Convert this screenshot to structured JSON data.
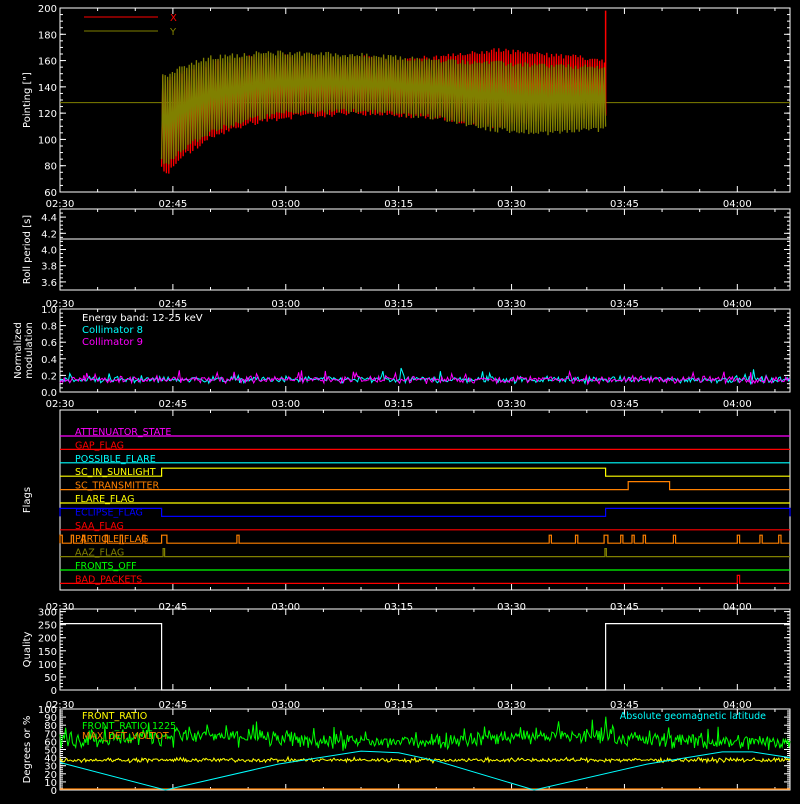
{
  "chart_data": [
    {
      "type": "line",
      "panel": "pointing",
      "ylabel": "Pointing [\"]",
      "ylim": [
        60,
        200
      ],
      "yticks": [
        60,
        80,
        100,
        120,
        140,
        160,
        180,
        200
      ],
      "xlim_minutes": [
        0,
        97
      ],
      "xticks": [
        "02:30",
        "02:45",
        "03:00",
        "03:15",
        "03:30",
        "03:45",
        "04:00"
      ],
      "xticks_minutes": [
        0,
        15,
        30,
        45,
        60,
        75,
        90
      ],
      "legend": [
        {
          "name": "X",
          "color": "#ff0000"
        },
        {
          "name": "Y",
          "color": "#808000"
        }
      ],
      "series": [
        {
          "name": "X",
          "color": "#ff0000",
          "envelope_x": [
            "02:43.5",
            "02:44",
            "02:46",
            "02:50",
            "02:55",
            "03:00",
            "03:10",
            "03:20",
            "03:28",
            "03:35",
            "03:40",
            "03:42.5"
          ],
          "upper": [
            150,
            143,
            150,
            158,
            162,
            163,
            162,
            162,
            168,
            164,
            162,
            160
          ],
          "lower": [
            80,
            72,
            86,
            101,
            112,
            117,
            120,
            117,
            110,
            114,
            117,
            118
          ],
          "end_spike": 198
        },
        {
          "name": "Y",
          "color": "#808000",
          "envelope_x": [
            "02:43.5",
            "02:44",
            "02:46",
            "02:50",
            "02:55",
            "03:00",
            "03:10",
            "03:20",
            "03:28",
            "03:35",
            "03:40",
            "03:42.5"
          ],
          "upper": [
            153,
            148,
            155,
            162,
            165,
            166,
            164,
            160,
            158,
            156,
            155,
            155
          ],
          "lower": [
            86,
            80,
            92,
            106,
            115,
            120,
            122,
            117,
            107,
            105,
            107,
            108
          ],
          "baseline": 128
        }
      ]
    },
    {
      "type": "line",
      "panel": "roll_period",
      "ylabel": "Roll period [s]",
      "ylim": [
        3.5,
        4.5
      ],
      "yticks": [
        3.6,
        3.8,
        4.0,
        4.2,
        4.4
      ],
      "ytick_labels": [
        "3.6",
        "3.8",
        "4.0",
        "4.2",
        "4.4"
      ],
      "xticks": [
        "02:30",
        "02:45",
        "03:00",
        "03:15",
        "03:30",
        "03:45",
        "04:00"
      ],
      "series": [
        {
          "name": "",
          "color": "#ffffff",
          "constant": 4.13
        }
      ]
    },
    {
      "type": "line",
      "panel": "modulation",
      "ylabel": "Normalized modulation",
      "ylabel_lines": [
        "Normalized",
        "modulation"
      ],
      "ylim": [
        0,
        1
      ],
      "yticks": [
        0,
        0.2,
        0.4,
        0.6,
        0.8,
        1.0
      ],
      "ytick_labels": [
        "0.0",
        "0.2",
        "0.4",
        "0.6",
        "0.8",
        "1.0"
      ],
      "xticks": [
        "02:30",
        "02:45",
        "03:00",
        "03:15",
        "03:30",
        "03:45",
        "04:00"
      ],
      "annotation": "Energy band: 12-25 keV",
      "legend": [
        {
          "name": "Collimator 8",
          "color": "#00ffff"
        },
        {
          "name": "Collimator 9",
          "color": "#ff00ff"
        }
      ],
      "series": [
        {
          "name": "Collimator 8",
          "color": "#00ffff",
          "mean": 0.15,
          "noise": 0.04
        },
        {
          "name": "Collimator 9",
          "color": "#ff00ff",
          "mean": 0.15,
          "noise": 0.04
        }
      ]
    },
    {
      "type": "line",
      "panel": "flags",
      "ylabel": "Flags",
      "xticks": [
        "02:30",
        "02:45",
        "03:00",
        "03:15",
        "03:30",
        "03:45",
        "04:00"
      ],
      "flags": [
        {
          "name": "ATTENUATOR_STATE",
          "color": "#ff00ff",
          "on": []
        },
        {
          "name": "GAP_FLAG",
          "color": "#ff0000",
          "on": []
        },
        {
          "name": "POSSIBLE_FLARE",
          "color": "#00ffff",
          "on": []
        },
        {
          "name": "SC_IN_SUNLIGHT",
          "color": "#ffff00",
          "on": [
            [
              "02:43.5",
              "03:42.5"
            ]
          ]
        },
        {
          "name": "SC_TRANSMITTER",
          "color": "#ff8000",
          "on": [
            [
              "03:45.5",
              "03:51"
            ]
          ]
        },
        {
          "name": "FLARE_FLAG",
          "color": "#ffff00",
          "on": []
        },
        {
          "name": "ECLIPSE_FLAG",
          "color": "#0000ff",
          "on": [
            [
              "02:30",
              "02:43.5"
            ],
            [
              "03:42.5",
              "04:07"
            ]
          ]
        },
        {
          "name": "SAA_FLAG",
          "color": "#ff0000",
          "on": []
        },
        {
          "name": "PARTICLE_FLAG",
          "color": "#ff8000",
          "on": [
            [
              "02:30",
              "02:30.3"
            ],
            [
              "02:31.5",
              "02:31.8"
            ],
            [
              "02:33",
              "02:33.3"
            ],
            [
              "02:36",
              "02:36.3"
            ],
            [
              "02:38",
              "02:38.3"
            ],
            [
              "02:41",
              "02:41.3"
            ],
            [
              "02:43.5",
              "02:44.2"
            ],
            [
              "02:53.5",
              "02:53.8"
            ],
            [
              "03:35",
              "03:35.3"
            ],
            [
              "03:38.5",
              "03:38.8"
            ],
            [
              "03:42.3",
              "03:42.8"
            ],
            [
              "03:44.5",
              "03:44.8"
            ],
            [
              "03:46",
              "03:46.3"
            ],
            [
              "03:47.5",
              "03:47.8"
            ],
            [
              "03:51.5",
              "03:51.8"
            ],
            [
              "04:00",
              "04:00.3"
            ],
            [
              "04:03",
              "04:03.3"
            ],
            [
              "04:05.5",
              "04:05.8"
            ]
          ]
        },
        {
          "name": "AAZ_FLAG",
          "color": "#808000",
          "on": [
            [
              "02:43.7",
              "02:43.9"
            ],
            [
              "03:42.4",
              "03:42.6"
            ]
          ]
        },
        {
          "name": "FRONTS_OFF",
          "color": "#00ff00",
          "on": []
        },
        {
          "name": "BAD_PACKETS",
          "color": "#ff0000",
          "on": [
            [
              "04:00",
              "04:00.3"
            ]
          ]
        }
      ]
    },
    {
      "type": "line",
      "panel": "quality",
      "ylabel": "Quality",
      "ylim": [
        0,
        310
      ],
      "yticks": [
        0,
        50,
        100,
        150,
        200,
        250,
        300
      ],
      "xticks": [
        "02:30",
        "02:45",
        "03:00",
        "03:15",
        "03:30",
        "03:45",
        "04:00"
      ],
      "series": [
        {
          "name": "",
          "color": "#ffffff",
          "steps": [
            [
              "02:30",
              254
            ],
            [
              "02:43.5",
              0
            ],
            [
              "03:42.5",
              254
            ],
            [
              "04:07",
              254
            ]
          ]
        }
      ]
    },
    {
      "type": "line",
      "panel": "ratios",
      "ylabel": "Degrees or %",
      "ylim": [
        0,
        100
      ],
      "yticks": [
        0,
        10,
        20,
        30,
        40,
        50,
        60,
        70,
        80,
        90,
        100
      ],
      "xticks": [
        "02:30",
        "02:45",
        "03:00",
        "03:15",
        "03:30",
        "03:45",
        "04:00"
      ],
      "legend": [
        {
          "name": "FRONT_RATIO",
          "color": "#ffff00"
        },
        {
          "name": "FRONT_RATIO_1225",
          "color": "#00ff00"
        },
        {
          "name": "MAX_DET_VOLTOT",
          "color": "#ff8000"
        }
      ],
      "annotation": "Absolute geomagnetic latitude",
      "annotation_color": "#00ffff",
      "series": [
        {
          "name": "FRONT_RATIO",
          "color": "#ffff00",
          "mean": 37,
          "noise": 2.5
        },
        {
          "name": "FRONT_RATIO_1225",
          "color": "#00ff00",
          "mean": 63,
          "noise": 10
        },
        {
          "name": "MAX_DET_VOLTOT",
          "color": "#ff8000",
          "constant": 0
        },
        {
          "name": "Absolute geomagnetic latitude",
          "color": "#00ffff",
          "points": [
            [
              "02:30",
              34
            ],
            [
              "02:44",
              0
            ],
            [
              "02:59",
              32
            ],
            [
              "03:10",
              48
            ],
            [
              "03:15",
              46
            ],
            [
              "03:20",
              36
            ],
            [
              "03:33",
              0
            ],
            [
              "03:48",
              32
            ],
            [
              "03:58",
              47
            ],
            [
              "04:02",
              47
            ],
            [
              "04:07",
              40
            ]
          ]
        }
      ]
    }
  ]
}
